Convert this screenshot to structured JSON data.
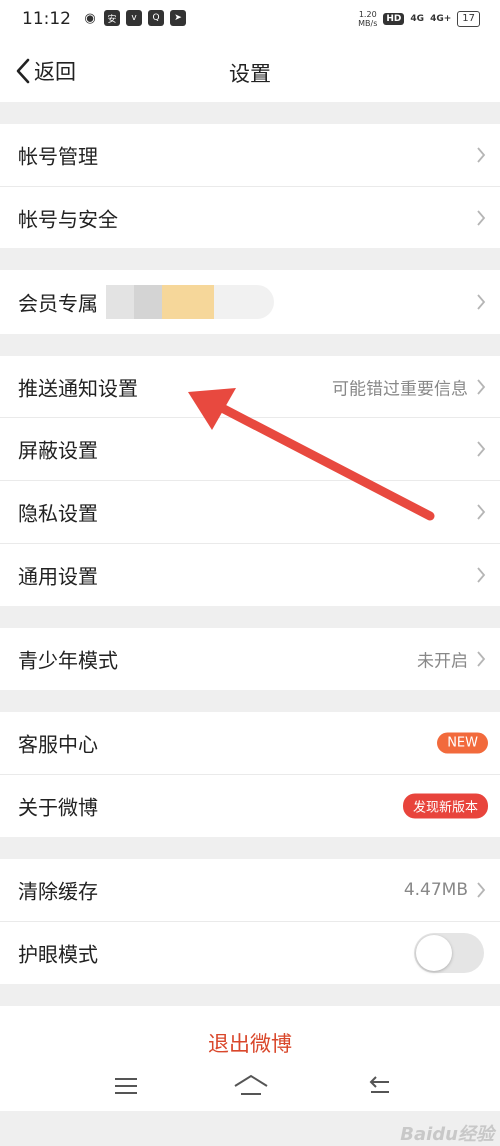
{
  "status_bar": {
    "time": "11:12",
    "app_icons": [
      "微博",
      "安",
      "Vivo",
      "Q",
      "◂"
    ],
    "net_speed_value": "1.20",
    "net_speed_unit": "MB/s",
    "hd": "HD",
    "sig1": "4G",
    "sig2": "4G+",
    "battery": "17"
  },
  "header": {
    "back_label": "返回",
    "title": "设置"
  },
  "groups": {
    "account": {
      "manage": "帐号管理",
      "security": "帐号与安全"
    },
    "member": {
      "label": "会员专属"
    },
    "settings": {
      "push": "推送通知设置",
      "push_hint": "可能错过重要信息",
      "block": "屏蔽设置",
      "privacy": "隐私设置",
      "general": "通用设置"
    },
    "youth": {
      "label": "青少年模式",
      "value": "未开启"
    },
    "help": {
      "service": "客服中心",
      "service_badge": "NEW",
      "about": "关于微博",
      "about_badge": "发现新版本"
    },
    "storage": {
      "clear_cache": "清除缓存",
      "cache_size": "4.47MB",
      "eye_mode": "护眼模式",
      "eye_mode_on": false
    }
  },
  "logout": {
    "label": "退出微博"
  },
  "watermark": "Baidu经验",
  "colors": {
    "accent": "#d9472b",
    "badge_new": "#f26a3c",
    "badge_version": "#e8443c",
    "annotation_arrow": "#e8493f"
  }
}
